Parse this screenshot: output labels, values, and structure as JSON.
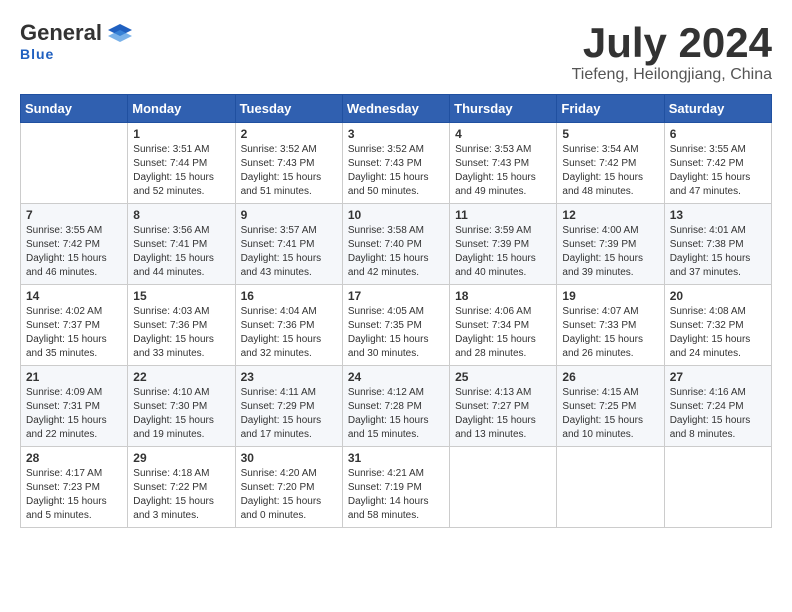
{
  "logo": {
    "general": "General",
    "blue": "Blue"
  },
  "header": {
    "month": "July 2024",
    "location": "Tiefeng, Heilongjiang, China"
  },
  "weekdays": [
    "Sunday",
    "Monday",
    "Tuesday",
    "Wednesday",
    "Thursday",
    "Friday",
    "Saturday"
  ],
  "weeks": [
    [
      {
        "day": "",
        "sunrise": "",
        "sunset": "",
        "daylight": ""
      },
      {
        "day": "1",
        "sunrise": "Sunrise: 3:51 AM",
        "sunset": "Sunset: 7:44 PM",
        "daylight": "Daylight: 15 hours and 52 minutes."
      },
      {
        "day": "2",
        "sunrise": "Sunrise: 3:52 AM",
        "sunset": "Sunset: 7:43 PM",
        "daylight": "Daylight: 15 hours and 51 minutes."
      },
      {
        "day": "3",
        "sunrise": "Sunrise: 3:52 AM",
        "sunset": "Sunset: 7:43 PM",
        "daylight": "Daylight: 15 hours and 50 minutes."
      },
      {
        "day": "4",
        "sunrise": "Sunrise: 3:53 AM",
        "sunset": "Sunset: 7:43 PM",
        "daylight": "Daylight: 15 hours and 49 minutes."
      },
      {
        "day": "5",
        "sunrise": "Sunrise: 3:54 AM",
        "sunset": "Sunset: 7:42 PM",
        "daylight": "Daylight: 15 hours and 48 minutes."
      },
      {
        "day": "6",
        "sunrise": "Sunrise: 3:55 AM",
        "sunset": "Sunset: 7:42 PM",
        "daylight": "Daylight: 15 hours and 47 minutes."
      }
    ],
    [
      {
        "day": "7",
        "sunrise": "Sunrise: 3:55 AM",
        "sunset": "Sunset: 7:42 PM",
        "daylight": "Daylight: 15 hours and 46 minutes."
      },
      {
        "day": "8",
        "sunrise": "Sunrise: 3:56 AM",
        "sunset": "Sunset: 7:41 PM",
        "daylight": "Daylight: 15 hours and 44 minutes."
      },
      {
        "day": "9",
        "sunrise": "Sunrise: 3:57 AM",
        "sunset": "Sunset: 7:41 PM",
        "daylight": "Daylight: 15 hours and 43 minutes."
      },
      {
        "day": "10",
        "sunrise": "Sunrise: 3:58 AM",
        "sunset": "Sunset: 7:40 PM",
        "daylight": "Daylight: 15 hours and 42 minutes."
      },
      {
        "day": "11",
        "sunrise": "Sunrise: 3:59 AM",
        "sunset": "Sunset: 7:39 PM",
        "daylight": "Daylight: 15 hours and 40 minutes."
      },
      {
        "day": "12",
        "sunrise": "Sunrise: 4:00 AM",
        "sunset": "Sunset: 7:39 PM",
        "daylight": "Daylight: 15 hours and 39 minutes."
      },
      {
        "day": "13",
        "sunrise": "Sunrise: 4:01 AM",
        "sunset": "Sunset: 7:38 PM",
        "daylight": "Daylight: 15 hours and 37 minutes."
      }
    ],
    [
      {
        "day": "14",
        "sunrise": "Sunrise: 4:02 AM",
        "sunset": "Sunset: 7:37 PM",
        "daylight": "Daylight: 15 hours and 35 minutes."
      },
      {
        "day": "15",
        "sunrise": "Sunrise: 4:03 AM",
        "sunset": "Sunset: 7:36 PM",
        "daylight": "Daylight: 15 hours and 33 minutes."
      },
      {
        "day": "16",
        "sunrise": "Sunrise: 4:04 AM",
        "sunset": "Sunset: 7:36 PM",
        "daylight": "Daylight: 15 hours and 32 minutes."
      },
      {
        "day": "17",
        "sunrise": "Sunrise: 4:05 AM",
        "sunset": "Sunset: 7:35 PM",
        "daylight": "Daylight: 15 hours and 30 minutes."
      },
      {
        "day": "18",
        "sunrise": "Sunrise: 4:06 AM",
        "sunset": "Sunset: 7:34 PM",
        "daylight": "Daylight: 15 hours and 28 minutes."
      },
      {
        "day": "19",
        "sunrise": "Sunrise: 4:07 AM",
        "sunset": "Sunset: 7:33 PM",
        "daylight": "Daylight: 15 hours and 26 minutes."
      },
      {
        "day": "20",
        "sunrise": "Sunrise: 4:08 AM",
        "sunset": "Sunset: 7:32 PM",
        "daylight": "Daylight: 15 hours and 24 minutes."
      }
    ],
    [
      {
        "day": "21",
        "sunrise": "Sunrise: 4:09 AM",
        "sunset": "Sunset: 7:31 PM",
        "daylight": "Daylight: 15 hours and 22 minutes."
      },
      {
        "day": "22",
        "sunrise": "Sunrise: 4:10 AM",
        "sunset": "Sunset: 7:30 PM",
        "daylight": "Daylight: 15 hours and 19 minutes."
      },
      {
        "day": "23",
        "sunrise": "Sunrise: 4:11 AM",
        "sunset": "Sunset: 7:29 PM",
        "daylight": "Daylight: 15 hours and 17 minutes."
      },
      {
        "day": "24",
        "sunrise": "Sunrise: 4:12 AM",
        "sunset": "Sunset: 7:28 PM",
        "daylight": "Daylight: 15 hours and 15 minutes."
      },
      {
        "day": "25",
        "sunrise": "Sunrise: 4:13 AM",
        "sunset": "Sunset: 7:27 PM",
        "daylight": "Daylight: 15 hours and 13 minutes."
      },
      {
        "day": "26",
        "sunrise": "Sunrise: 4:15 AM",
        "sunset": "Sunset: 7:25 PM",
        "daylight": "Daylight: 15 hours and 10 minutes."
      },
      {
        "day": "27",
        "sunrise": "Sunrise: 4:16 AM",
        "sunset": "Sunset: 7:24 PM",
        "daylight": "Daylight: 15 hours and 8 minutes."
      }
    ],
    [
      {
        "day": "28",
        "sunrise": "Sunrise: 4:17 AM",
        "sunset": "Sunset: 7:23 PM",
        "daylight": "Daylight: 15 hours and 5 minutes."
      },
      {
        "day": "29",
        "sunrise": "Sunrise: 4:18 AM",
        "sunset": "Sunset: 7:22 PM",
        "daylight": "Daylight: 15 hours and 3 minutes."
      },
      {
        "day": "30",
        "sunrise": "Sunrise: 4:20 AM",
        "sunset": "Sunset: 7:20 PM",
        "daylight": "Daylight: 15 hours and 0 minutes."
      },
      {
        "day": "31",
        "sunrise": "Sunrise: 4:21 AM",
        "sunset": "Sunset: 7:19 PM",
        "daylight": "Daylight: 14 hours and 58 minutes."
      },
      {
        "day": "",
        "sunrise": "",
        "sunset": "",
        "daylight": ""
      },
      {
        "day": "",
        "sunrise": "",
        "sunset": "",
        "daylight": ""
      },
      {
        "day": "",
        "sunrise": "",
        "sunset": "",
        "daylight": ""
      }
    ]
  ]
}
